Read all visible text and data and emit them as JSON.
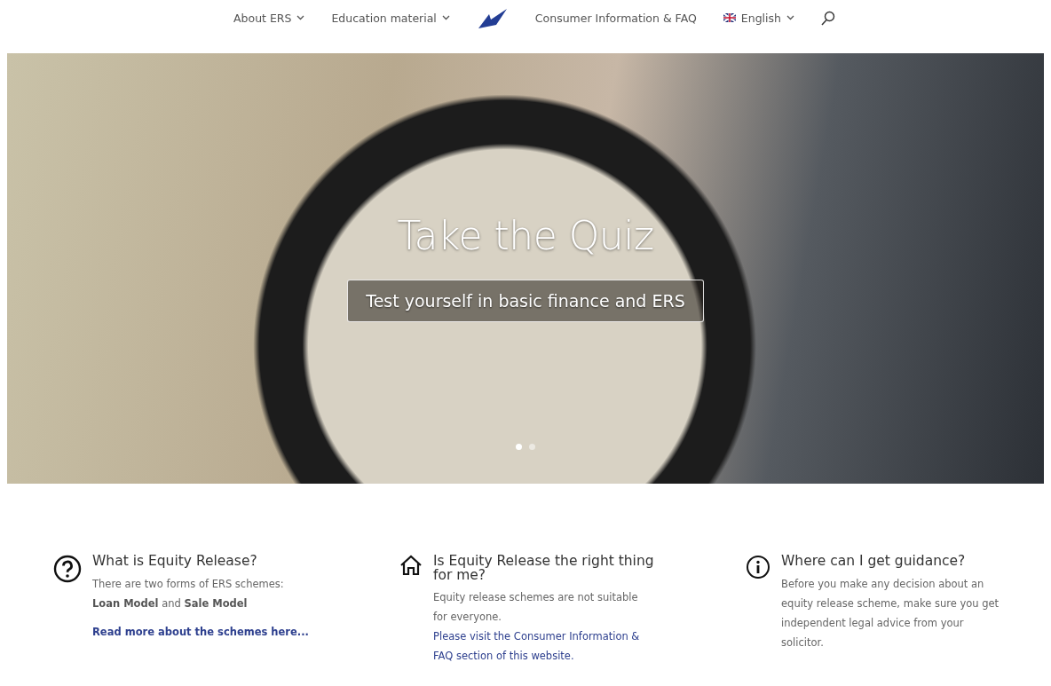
{
  "nav": {
    "items": [
      {
        "label": "About ERS",
        "has_menu": true
      },
      {
        "label": "Education material",
        "has_menu": true
      },
      {
        "kind": "logo"
      },
      {
        "label": "Consumer Information & FAQ",
        "has_menu": false
      },
      {
        "label": "English",
        "has_menu": true,
        "flag": true
      }
    ]
  },
  "hero": {
    "title": "Take the Quiz",
    "button": "Test yourself in basic finance and ERS",
    "dots": [
      {
        "selected": true
      },
      {
        "selected": false
      }
    ]
  },
  "features": [
    {
      "kind": "question",
      "title": "What is Equity Release?",
      "body": "There are two forms of ERS schemes: **Loan Model** and **Sale Model**",
      "link": "Read more about the schemes here..."
    },
    {
      "kind": "home",
      "title": "Is Equity Release the right thing for me?",
      "body": "Equity release schemes are not suitable for everyone.",
      "inline_link": "Please visit the Consumer Information & FAQ section of this website."
    },
    {
      "kind": "info",
      "title": "Where can I get guidance?",
      "body": "Before you make any decision about an equity release scheme, make sure you get independent legal advice from your solicitor."
    }
  ]
}
